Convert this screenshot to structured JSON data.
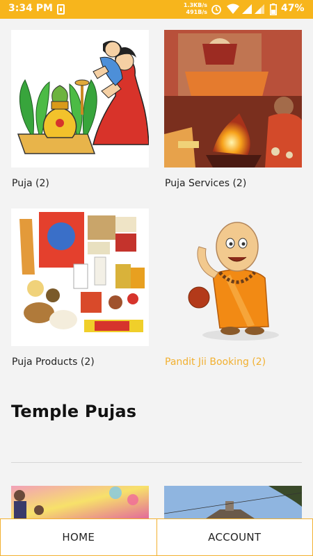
{
  "status_bar": {
    "time": "3:34 PM",
    "speed_up": "1.3KB/s",
    "speed_down": "491B/s",
    "battery": "47%",
    "icons": [
      "app-notification-icon",
      "alarm-icon",
      "wifi-icon",
      "signal-icon",
      "signal-icon",
      "battery-icon"
    ]
  },
  "categories": [
    {
      "label": "Puja (2)"
    },
    {
      "label": "Puja Services (2)"
    },
    {
      "label": "Puja Products (2)"
    },
    {
      "label": "Pandit Jii Booking (2)"
    }
  ],
  "section": {
    "title": "Temple Pujas"
  },
  "bottom_nav": {
    "home": "HOME",
    "account": "ACCOUNT"
  },
  "colors": {
    "accent": "#f7b51c",
    "link_accent": "#f2b030",
    "background": "#f3f3f3"
  }
}
